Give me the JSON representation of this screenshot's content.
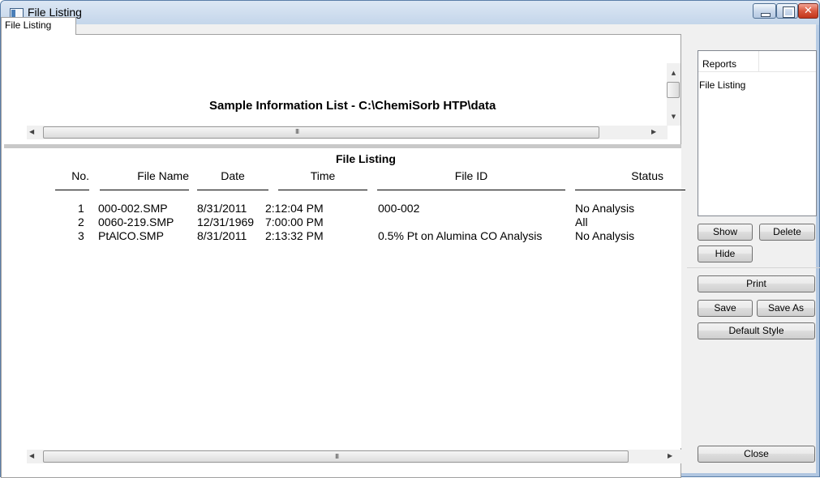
{
  "window": {
    "title": "File Listing"
  },
  "tab": {
    "label": "File Listing"
  },
  "sheet": {
    "title": "Sample Information List - C:\\ChemiSorb HTP\\data"
  },
  "listing": {
    "heading": "File Listing",
    "columns": {
      "no": "No.",
      "file_name": "File Name",
      "date": "Date",
      "time": "Time",
      "file_id": "File ID",
      "status": "Status"
    },
    "rows": [
      {
        "no": "1",
        "file_name": "000-002.SMP",
        "date": "8/31/2011",
        "time": "2:12:04 PM",
        "file_id": "000-002",
        "status": "No Analysis"
      },
      {
        "no": "2",
        "file_name": "0060-219.SMP",
        "date": "12/31/1969",
        "time": "7:00:00 PM",
        "file_id": "",
        "status": "All"
      },
      {
        "no": "3",
        "file_name": "PtAlCO.SMP",
        "date": "8/31/2011",
        "time": "2:13:32 PM",
        "file_id": "0.5% Pt on Alumina CO Analysis",
        "status": "No Analysis"
      }
    ]
  },
  "reports": {
    "header": "Reports",
    "items": [
      "File Listing"
    ]
  },
  "buttons": {
    "show": "Show",
    "delete": "Delete",
    "hide": "Hide",
    "print": "Print",
    "save": "Save",
    "save_as": "Save As",
    "default_style": "Default Style",
    "close": "Close"
  },
  "scrollbar": {
    "grip": "III"
  }
}
